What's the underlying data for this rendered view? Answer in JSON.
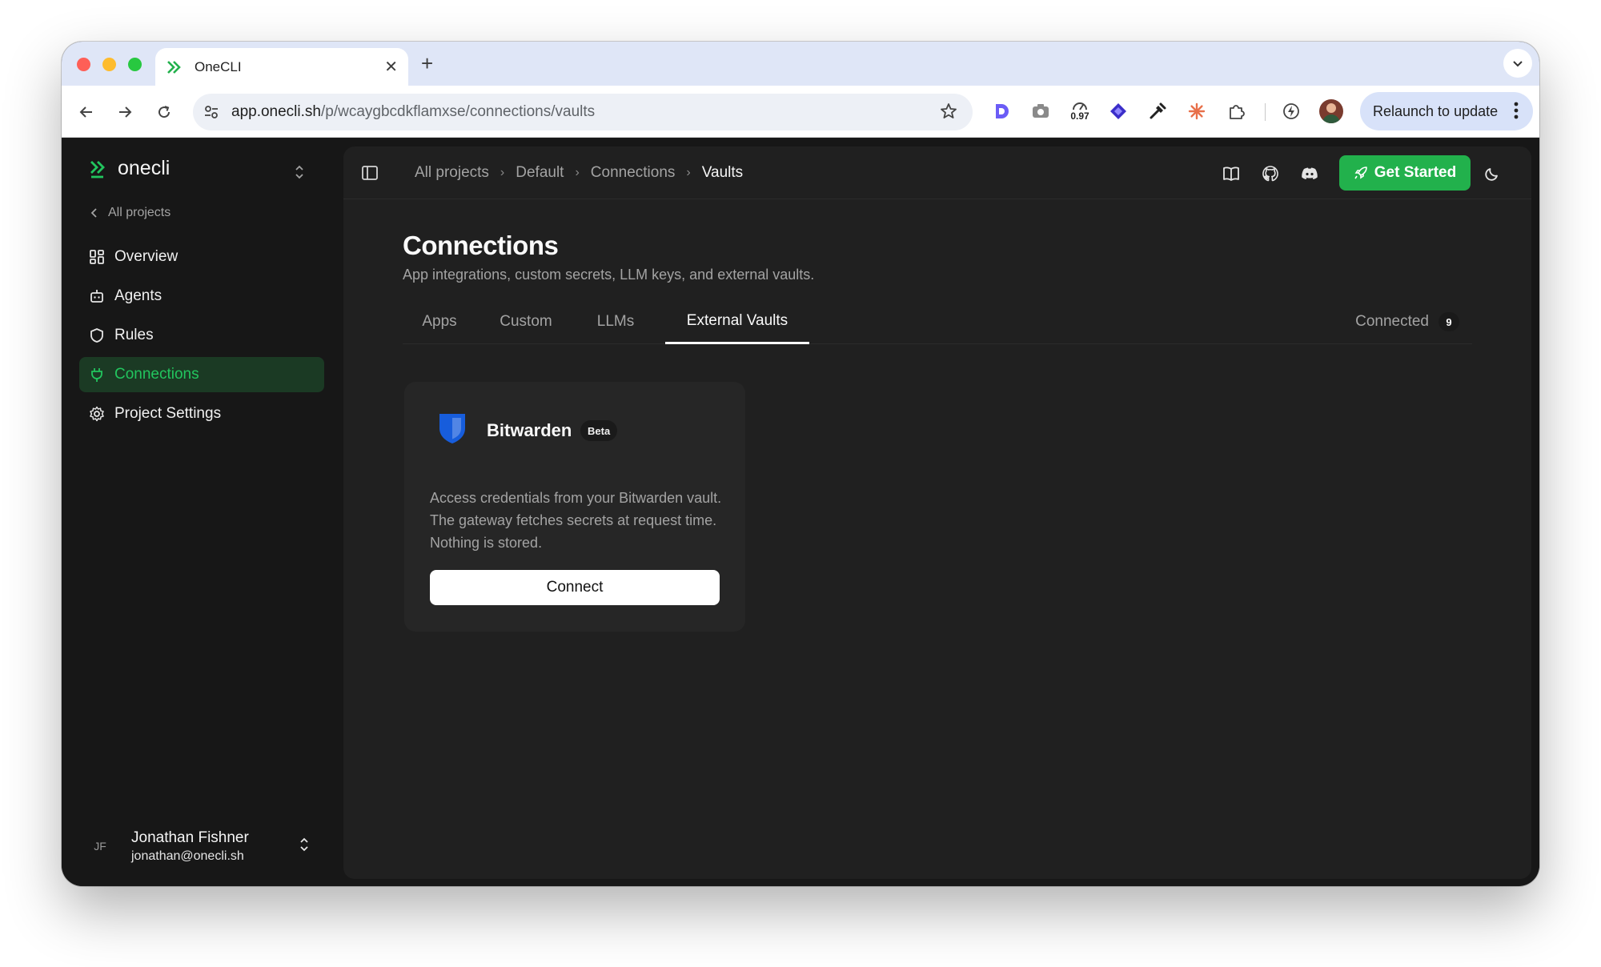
{
  "browser": {
    "tab_title": "OneCLI",
    "url_host": "app.onecli.sh",
    "url_path": "/p/wcaygbcdkflamxse/connections/vaults",
    "extension_badge": "0.97",
    "relaunch_label": "Relaunch to update"
  },
  "sidebar": {
    "brand": "onecli",
    "back_label": "All projects",
    "items": [
      {
        "label": "Overview",
        "icon": "grid-icon"
      },
      {
        "label": "Agents",
        "icon": "bot-icon"
      },
      {
        "label": "Rules",
        "icon": "shield-icon"
      },
      {
        "label": "Connections",
        "icon": "plug-icon",
        "active": true
      },
      {
        "label": "Project Settings",
        "icon": "gear-icon"
      }
    ],
    "user": {
      "initials": "JF",
      "name": "Jonathan Fishner",
      "email": "jonathan@onecli.sh"
    }
  },
  "header": {
    "breadcrumbs": [
      "All projects",
      "Default",
      "Connections",
      "Vaults"
    ],
    "get_started_label": "Get Started"
  },
  "page": {
    "title": "Connections",
    "subtitle": "App integrations, custom secrets, LLM keys, and external vaults.",
    "tabs": [
      "Apps",
      "Custom",
      "LLMs",
      "External Vaults"
    ],
    "active_tab": "External Vaults",
    "connected_label": "Connected",
    "connected_count": "9"
  },
  "vault_card": {
    "name": "Bitwarden",
    "badge": "Beta",
    "description": "Access credentials from your Bitwarden vault. The gateway fetches secrets at request time. Nothing is stored.",
    "button_label": "Connect"
  },
  "colors": {
    "accent": "#22c55e",
    "button_green": "#22b14c",
    "background": "#171717",
    "panel": "#202020",
    "card": "#262626",
    "bitwarden_blue": "#175ddc"
  }
}
